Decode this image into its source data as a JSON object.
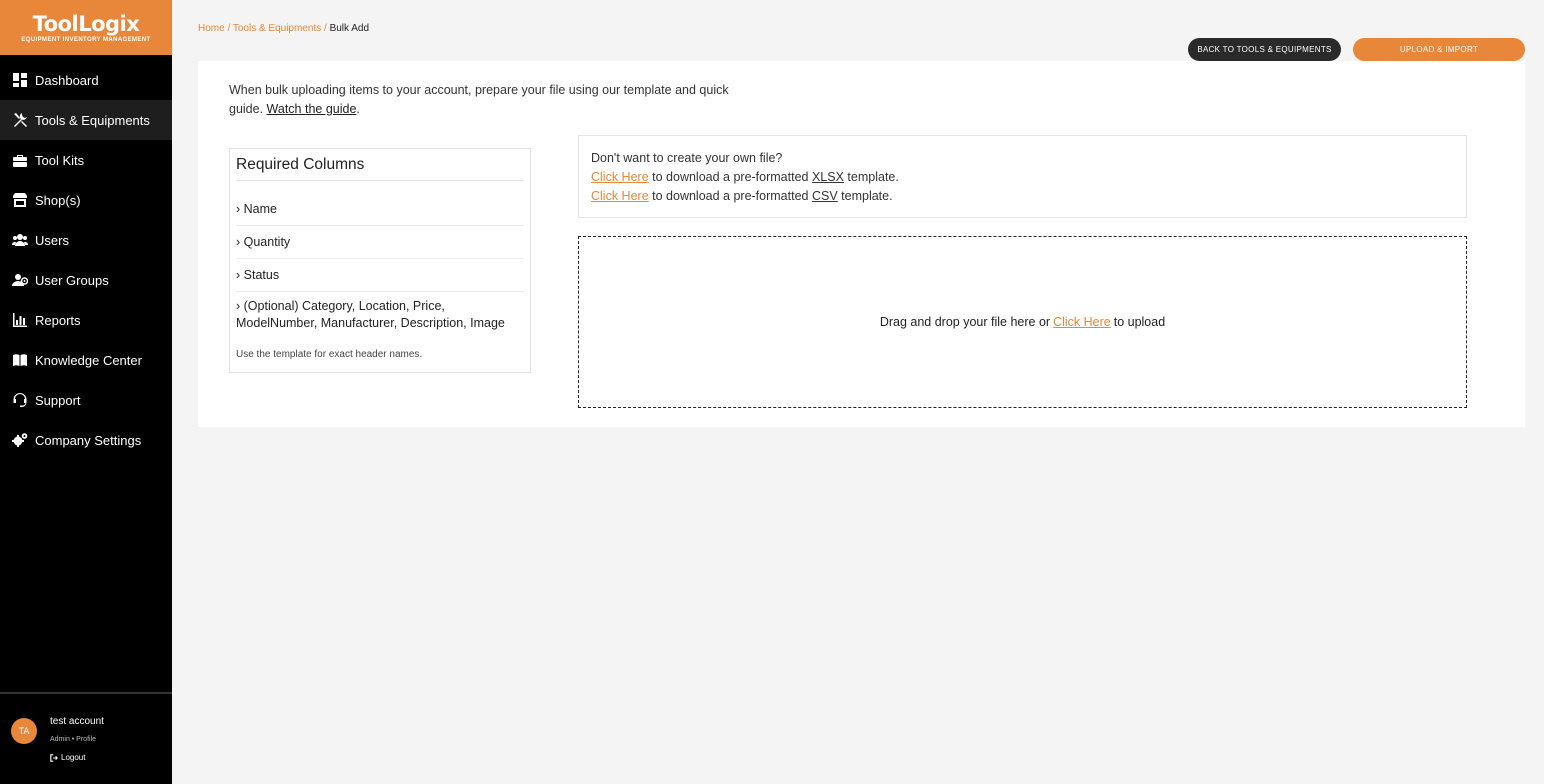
{
  "brand": {
    "name": "ToolLogix",
    "tagline": "EQUIPMENT INVENTORY MANAGEMENT",
    "accent_color": "#e8873a"
  },
  "sidebar": {
    "items": [
      {
        "label": "Dashboard",
        "icon": "dashboard-icon"
      },
      {
        "label": "Tools & Equipments",
        "icon": "tools-icon",
        "active": true
      },
      {
        "label": "Tool Kits",
        "icon": "toolbox-icon"
      },
      {
        "label": "Shop(s)",
        "icon": "shop-icon"
      },
      {
        "label": "Users",
        "icon": "users-icon"
      },
      {
        "label": "User Groups",
        "icon": "user-groups-icon"
      },
      {
        "label": "Reports",
        "icon": "reports-icon"
      },
      {
        "label": "Knowledge Center",
        "icon": "book-icon"
      },
      {
        "label": "Support",
        "icon": "headset-icon"
      },
      {
        "label": "Company Settings",
        "icon": "gears-icon"
      }
    ]
  },
  "user": {
    "initials": "TA",
    "name": "test account",
    "role": "Admin • Profile",
    "logout": "Logout"
  },
  "breadcrumb": {
    "home": "Home",
    "sep": " / ",
    "parent": "Tools & Equipments",
    "current": "Bulk Add"
  },
  "actions": {
    "back": "BACK TO TOOLS & EQUIPMENTS",
    "upload": "UPLOAD & IMPORT"
  },
  "intro": {
    "text": "When bulk uploading items to your account, prepare your file using our template and quick guide.",
    "link": "Watch the guide",
    "end": "."
  },
  "required": {
    "title": "Required Columns",
    "items": [
      "› Name",
      "› Quantity",
      "› Status",
      "› (Optional) Category, Location, Price, ModelNumber, Manufacturer, Description, Image"
    ],
    "note": "Use the template for exact header names."
  },
  "download": {
    "question": "Don't want to create your own file?",
    "click_here": "Click Here",
    "pre": "to download a pre-formatted",
    "xlsx": "XLSX",
    "csv": "CSV",
    "post": "template."
  },
  "dropzone": {
    "before": "Drag and drop your file here or",
    "link": "Click Here",
    "after": "to upload"
  }
}
